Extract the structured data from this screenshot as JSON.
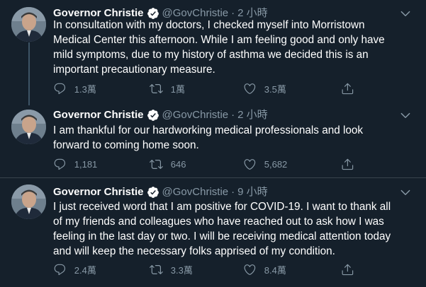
{
  "tweets": [
    {
      "name": "Governor Christie",
      "handle": "@GovChristie",
      "separator": "·",
      "time": "2 小時",
      "text": "In consultation with my doctors, I checked myself into Morristown\nMedical Center this afternoon. While I am feeling good and only have\nmild symptoms, due to my history of asthma we decided this is an\nimportant precautionary measure.",
      "replies": "1.3萬",
      "retweets": "1萬",
      "likes": "3.5萬"
    },
    {
      "name": "Governor Christie",
      "handle": "@GovChristie",
      "separator": "·",
      "time": "2 小時",
      "text": "I am thankful for our hardworking medical professionals and look\nforward to coming home soon.",
      "replies": "1,181",
      "retweets": "646",
      "likes": "5,682"
    },
    {
      "name": "Governor Christie",
      "handle": "@GovChristie",
      "separator": "·",
      "time": "9 小時",
      "text": "I just received word that I am positive for COVID-19. I want to thank all\nof my friends and colleagues who have reached out to ask how I was\nfeeling in the last day or two. I will be receiving medical attention today\nand will keep the necessary folks apprised of my condition.",
      "replies": "2.4萬",
      "retweets": "3.3萬",
      "likes": "8.4萬"
    }
  ],
  "colors": {
    "background": "#15202b",
    "text": "#ffffff",
    "secondary": "#8899a6",
    "verified": "#ffffff",
    "divider": "#38444d"
  },
  "icons": [
    "verified-badge-icon",
    "chevron-down-icon",
    "reply-icon",
    "retweet-icon",
    "like-icon",
    "share-icon"
  ]
}
